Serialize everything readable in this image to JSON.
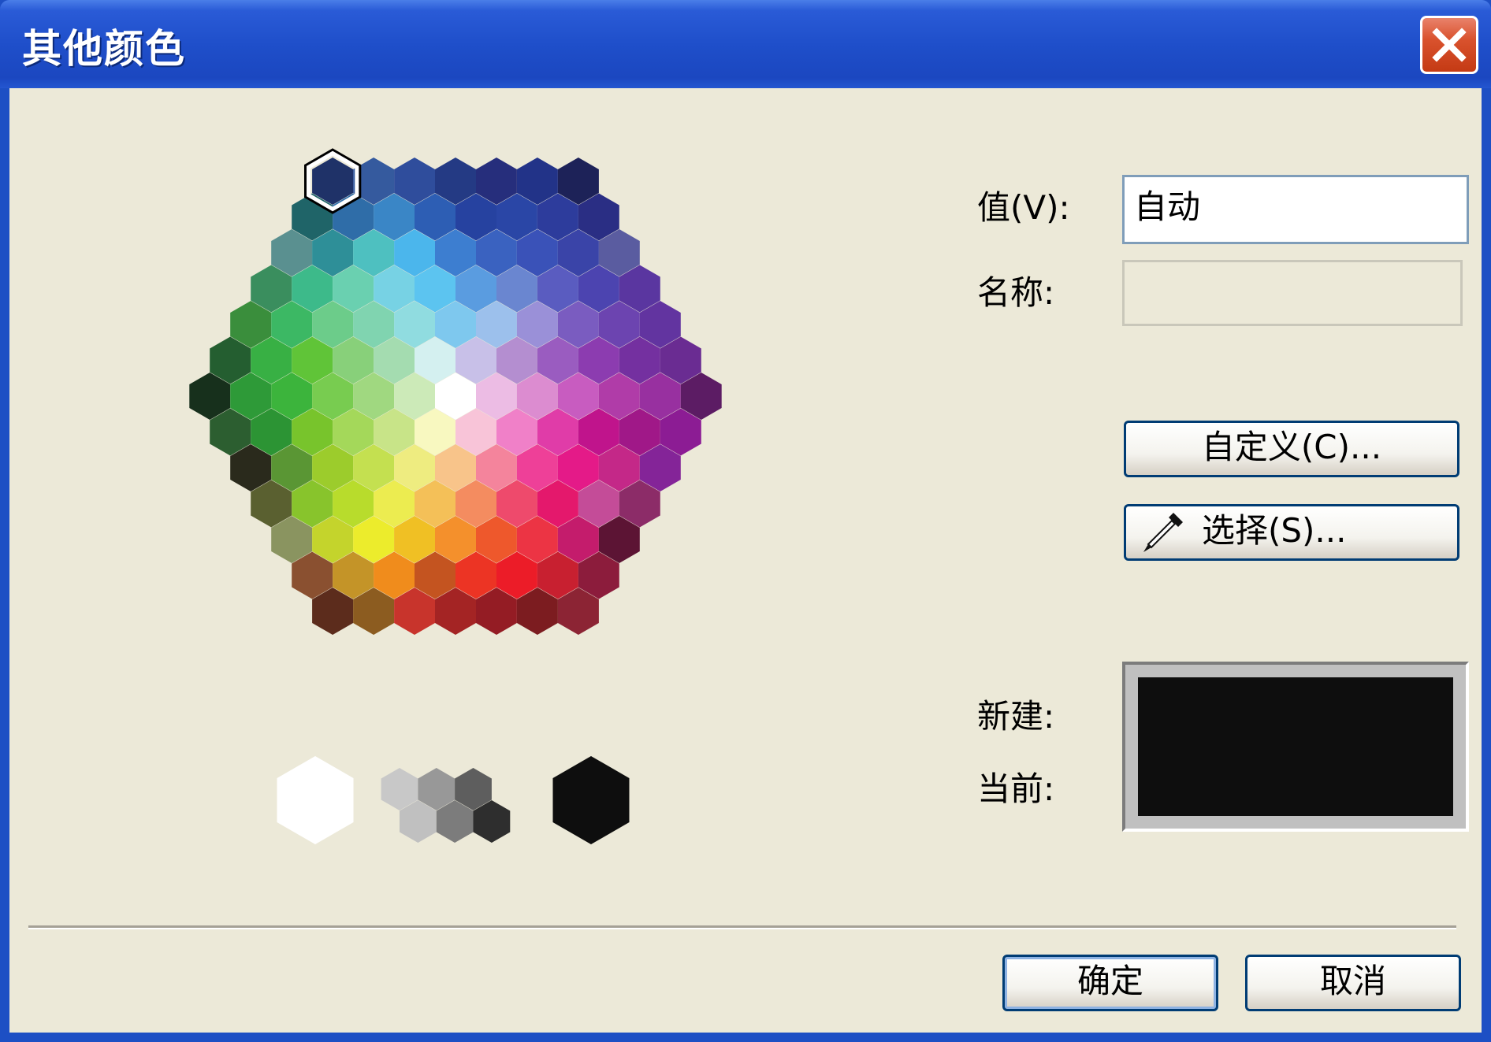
{
  "window": {
    "title": "其他颜色",
    "close_icon": "close-icon"
  },
  "form": {
    "value_label": "值(V):",
    "value": "自动",
    "name_label": "名称:",
    "name_value": "",
    "new_label": "新建:",
    "current_label": "当前:"
  },
  "buttons": {
    "custom": "自定义(C)...",
    "pick": "选择(S)...",
    "ok": "确定",
    "cancel": "取消"
  },
  "colors": {
    "new_color": "#0e0e0e",
    "current_color": "#0e0e0e",
    "selected": "#1f3268"
  },
  "palette": {
    "rows": [
      [
        "#1f3268",
        "#355a9e",
        "#2f4d9c",
        "#243a84",
        "#262e7c",
        "#223388",
        "#1d2258"
      ],
      [
        "#1f6468",
        "#2f6da8",
        "#3a86c6",
        "#2d5eb4",
        "#2642a0",
        "#2a46a6",
        "#2d3c9c",
        "#2a2e84"
      ],
      [
        "#5a9090",
        "#2e8f98",
        "#4ec0c0",
        "#4bb6ec",
        "#3d7ed0",
        "#3a62c0",
        "#3a52b8",
        "#3a44a8",
        "#5a5ca0"
      ],
      [
        "#3a8e5e",
        "#3dba8a",
        "#6ad0b0",
        "#77d2e4",
        "#5cc4f0",
        "#5a9ce0",
        "#6a86d0",
        "#5a5cc0",
        "#4c44b0",
        "#5a36a0"
      ],
      [
        "#3a8e3c",
        "#3cb864",
        "#6ccc8a",
        "#80d4b0",
        "#90dce0",
        "#7ec8ee",
        "#9cc0ec",
        "#9a90d8",
        "#7a5cc0",
        "#6c44b0",
        "#6234a0"
      ],
      [
        "#245e30",
        "#38b044",
        "#60c438",
        "#88d07a",
        "#a4dcb0",
        "#d4f0f0",
        "#c8c0e8",
        "#b48ed0",
        "#9a5cc0",
        "#8c3cb0",
        "#7430a0",
        "#6a2c92"
      ],
      [
        "#17301c",
        "#2e9a38",
        "#3cb43c",
        "#78cc50",
        "#a0d880",
        "#cceab8",
        "#ffffff",
        "#ecbce4",
        "#dc8cd0",
        "#c85cc0",
        "#b03ca8",
        "#9830a0",
        "#5c1c64"
      ],
      [
        "#2c5e30",
        "#2c9434",
        "#78c42c",
        "#a4d85a",
        "#c8e488",
        "#f8f8c0",
        "#f8c4d8",
        "#f080c8",
        "#e03ca8",
        "#c0148c",
        "#a01888",
        "#8c1c94"
      ],
      [
        "#2a2a1c",
        "#5a9634",
        "#9ccc2c",
        "#c4e050",
        "#eeec80",
        "#f8c48a",
        "#f4849c",
        "#ee4098",
        "#e41a88",
        "#c42888",
        "#842498"
      ],
      [
        "#5a6030",
        "#88c42c",
        "#b8dc2c",
        "#ecec50",
        "#f4c058",
        "#f48c60",
        "#ee4a6c",
        "#e4186c",
        "#c44c98",
        "#8c2c68"
      ],
      [
        "#8a9460",
        "#c4d42c",
        "#ecec2c",
        "#f0c024",
        "#f4902c",
        "#ee582c",
        "#ec3444",
        "#c41c6c",
        "#5c1434"
      ],
      [
        "#8a5030",
        "#c49428",
        "#f08c1c",
        "#c45420",
        "#ec3424",
        "#ec1c28",
        "#c82030",
        "#8c1c3c"
      ],
      [
        "#5c2c1c",
        "#8c5c20",
        "#c8342c",
        "#a42424",
        "#941c24",
        "#7c1c20",
        "#8c2434"
      ]
    ],
    "grays": [
      "#ffffff",
      "#c8c8c8",
      "#989898",
      "#5e5e5e",
      "#c0c0c0",
      "#7c7c7c",
      "#2e2e2e",
      "#0e0e0e"
    ]
  }
}
